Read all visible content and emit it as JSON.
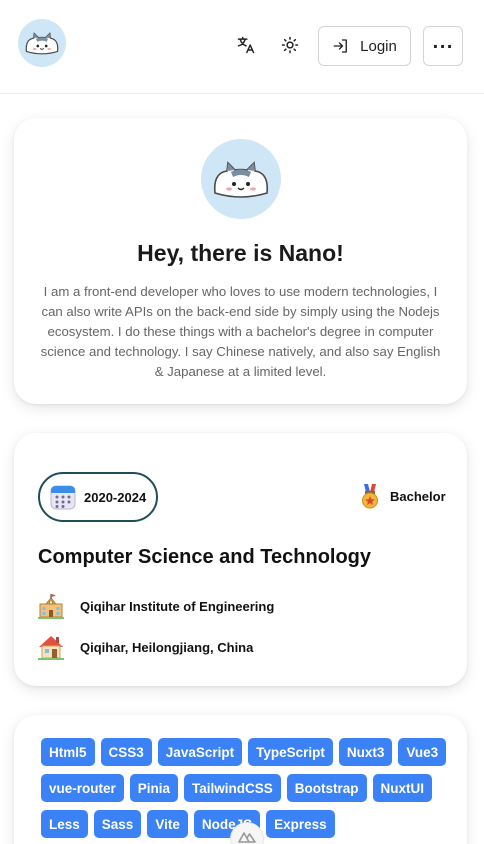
{
  "header": {
    "logo_icon": "cat-avatar-icon",
    "translate_icon": "translate-icon",
    "theme_icon": "sun-icon",
    "login_label": "Login",
    "login_icon": "login-icon",
    "more_label": "···"
  },
  "intro": {
    "avatar_icon": "cat-avatar-icon",
    "title": "Hey, there is Nano!",
    "bio": "I am a front-end developer who loves to use modern technologies, I can also write APIs on the back-end side by simply using the Nodejs ecosystem. I do these things with a bachelor's degree in computer science and technology. I say Chinese natively, and also say English & Japanese at a limited level."
  },
  "education": {
    "period": "2020-2024",
    "period_icon": "calendar-icon",
    "degree": "Bachelor",
    "degree_icon": "medal-icon",
    "major": "Computer Science and Technology",
    "school": "Qiqihar Institute of Engineering",
    "school_icon": "school-icon",
    "location": "Qiqihar, Heilongjiang, China",
    "location_icon": "house-icon"
  },
  "skills": {
    "tags": [
      "Html5",
      "CSS3",
      "JavaScript",
      "TypeScript",
      "Nuxt3",
      "Vue3",
      "vue-router",
      "Pinia",
      "TailwindCSS",
      "Bootstrap",
      "NuxtUI",
      "Less",
      "Sass",
      "Vite",
      "NodeJS",
      "Express"
    ]
  },
  "scroll_top_icon": "nuxt-logo-icon",
  "colors": {
    "accent": "#3b82f6",
    "pill_border": "#1f4d5c",
    "avatar_bg": "#cfe6f7"
  }
}
